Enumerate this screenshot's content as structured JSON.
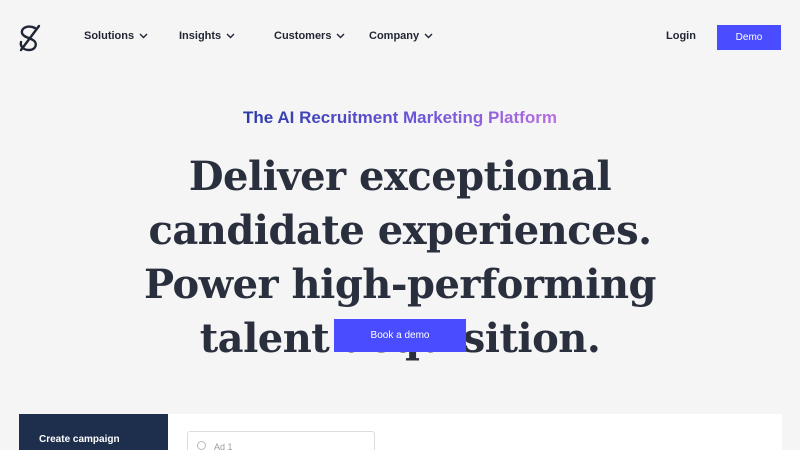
{
  "nav": {
    "items": [
      {
        "label": "Solutions"
      },
      {
        "label": "Insights"
      },
      {
        "label": "Customers"
      },
      {
        "label": "Company"
      }
    ],
    "login_label": "Login",
    "demo_label": "Demo"
  },
  "hero": {
    "tagline": "The AI Recruitment Marketing Platform",
    "headline": "Deliver exceptional candidate experiences. Power high-performing talent acquisition.",
    "cta_label": "Book a demo"
  },
  "preview": {
    "sidebar_label": "Create campaign",
    "ad_option": "Ad 1"
  },
  "colors": {
    "accent": "#4a4cff",
    "navy": "#1d2f4d",
    "background": "#f5f5f6"
  },
  "icons": {
    "logo": "brand-logo-icon",
    "dropdown": "chevron-down-icon"
  }
}
